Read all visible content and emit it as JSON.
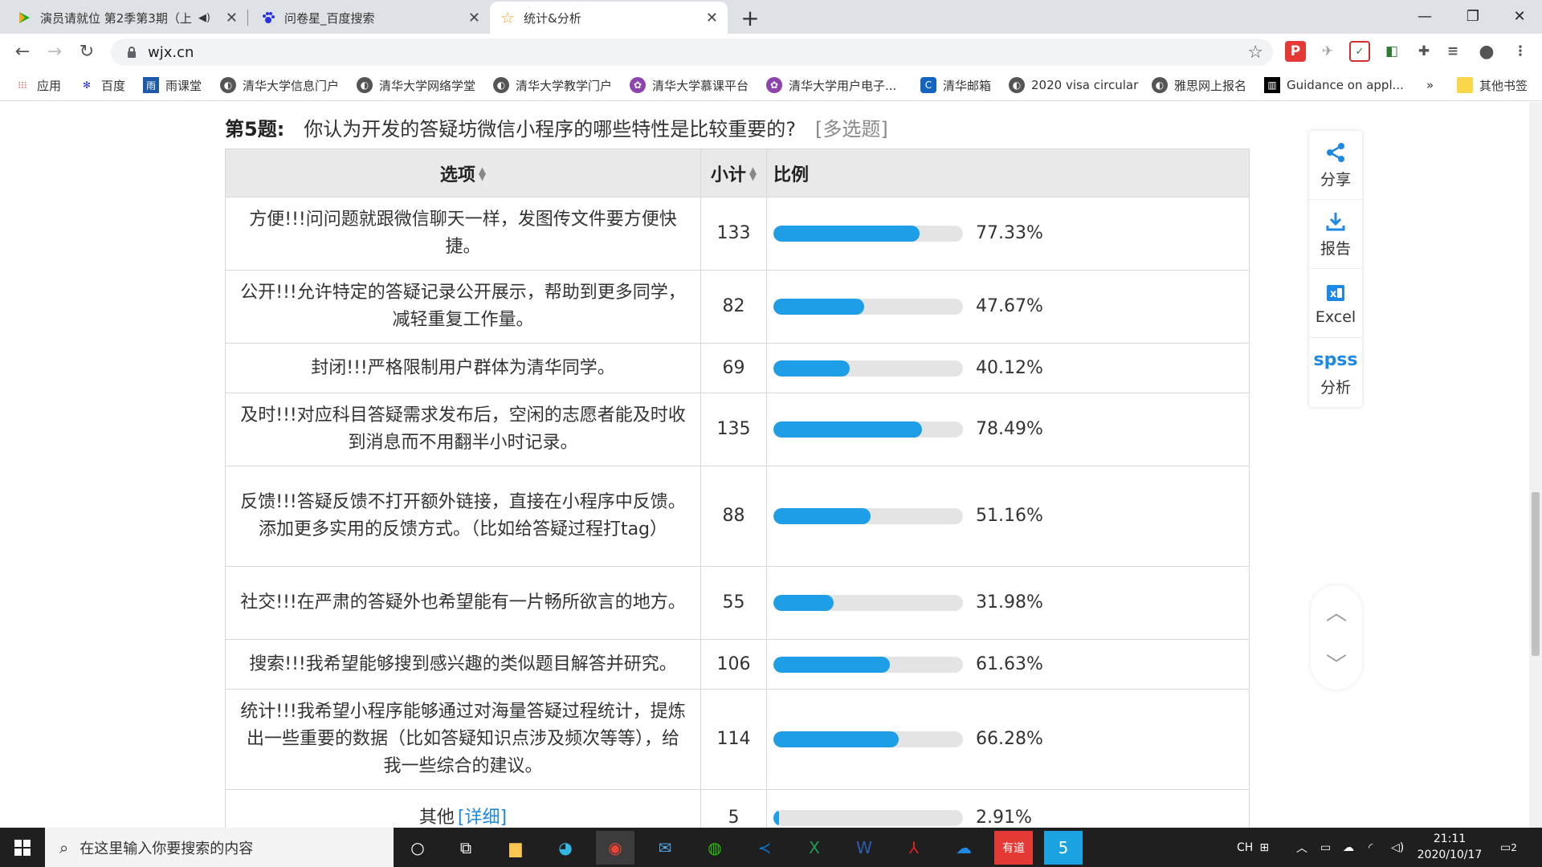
{
  "browser": {
    "tabs": [
      {
        "title": "演员请就位 第2季第3期（上",
        "active": false
      },
      {
        "title": "问卷星_百度搜索",
        "active": false
      },
      {
        "title": "统计&分析",
        "active": true
      }
    ],
    "url": "wjx.cn",
    "bookmarks": [
      "应用",
      "百度",
      "雨课堂",
      "清华大学信息门户",
      "清华大学网络学堂",
      "清华大学教学门户",
      "清华大学慕课平台",
      "清华大学用户电子...",
      "清华邮箱",
      "2020 visa circular",
      "雅思网上报名",
      "Guidance on appl...",
      "»",
      "其他书签"
    ]
  },
  "question": {
    "number": "第5题:",
    "text": "你认为开发的答疑坊微信小程序的哪些特性是比较重要的?",
    "type": "[多选题]"
  },
  "table": {
    "headers": {
      "option": "选项",
      "count": "小计",
      "ratio": "比例"
    },
    "rows": [
      {
        "option": "方便!!!问问题就跟微信聊天一样，发图传文件要方便快捷。",
        "count": "133",
        "percent": "77.33%",
        "value": 77.33
      },
      {
        "option": "公开!!!允许特定的答疑记录公开展示，帮助到更多同学，减轻重复工作量。",
        "count": "82",
        "percent": "47.67%",
        "value": 47.67
      },
      {
        "option": "封闭!!!严格限制用户群体为清华同学。",
        "count": "69",
        "percent": "40.12%",
        "value": 40.12
      },
      {
        "option": "及时!!!对应科目答疑需求发布后，空闲的志愿者能及时收到消息而不用翻半小时记录。",
        "count": "135",
        "percent": "78.49%",
        "value": 78.49
      },
      {
        "option": "反馈!!!答疑反馈不打开额外链接，直接在小程序中反馈。添加更多实用的反馈方式。（比如给答疑过程打tag）",
        "count": "88",
        "percent": "51.16%",
        "value": 51.16
      },
      {
        "option": "社交!!!在严肃的答疑外也希望能有一片畅所欲言的地方。",
        "count": "55",
        "percent": "31.98%",
        "value": 31.98
      },
      {
        "option": "搜索!!!我希望能够搜到感兴趣的类似题目解答并研究。",
        "count": "106",
        "percent": "61.63%",
        "value": 61.63
      },
      {
        "option": "统计!!!我希望小程序能够通过对海量答疑过程统计，提炼出一些重要的数据（比如答疑知识点涉及频次等等），给我一些综合的建议。",
        "count": "114",
        "percent": "66.28%",
        "value": 66.28
      },
      {
        "option": "其他",
        "detail": "[详细]",
        "count": "5",
        "percent": "2.91%",
        "value": 2.91
      }
    ]
  },
  "sidepanel": {
    "share": "分享",
    "report": "报告",
    "excel": "Excel",
    "spss_logo": "spss",
    "analyze": "分析"
  },
  "taskbar": {
    "search_placeholder": "在这里输入你要搜索的内容",
    "ime": "CH",
    "time": "21:11",
    "date": "2020/10/17",
    "notification_count": "2"
  },
  "colors": {
    "bar_fill": "#1e9ee6",
    "bar_track": "#e4e4e4",
    "accent": "#1e88e5"
  }
}
